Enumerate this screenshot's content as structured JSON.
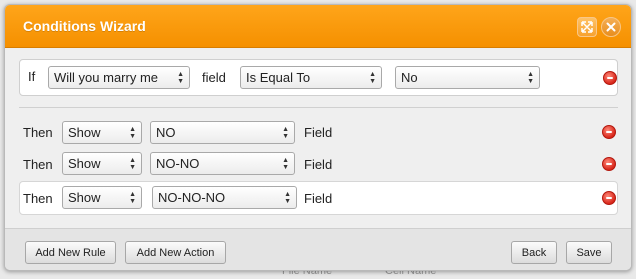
{
  "background": {
    "col1": "File Name",
    "col2": "Cell Name"
  },
  "dialog": {
    "title": "Conditions Wizard",
    "accent": "#f7a21b",
    "buttons": {
      "maximize_icon": "maximize-icon",
      "close_icon": "close-icon"
    }
  },
  "condition": {
    "prefix": "If",
    "field_select": "Will you marry me",
    "field_label": "field",
    "operator_select": "Is Equal To",
    "value_select": "No"
  },
  "actions": [
    {
      "prefix": "Then",
      "action": "Show",
      "target": "NO",
      "suffix": "Field"
    },
    {
      "prefix": "Then",
      "action": "Show",
      "target": "NO-NO",
      "suffix": "Field"
    },
    {
      "prefix": "Then",
      "action": "Show",
      "target": "NO-NO-NO",
      "suffix": "Field"
    }
  ],
  "footer": {
    "add_rule": "Add New Rule",
    "add_action": "Add New Action",
    "back": "Back",
    "save": "Save"
  }
}
